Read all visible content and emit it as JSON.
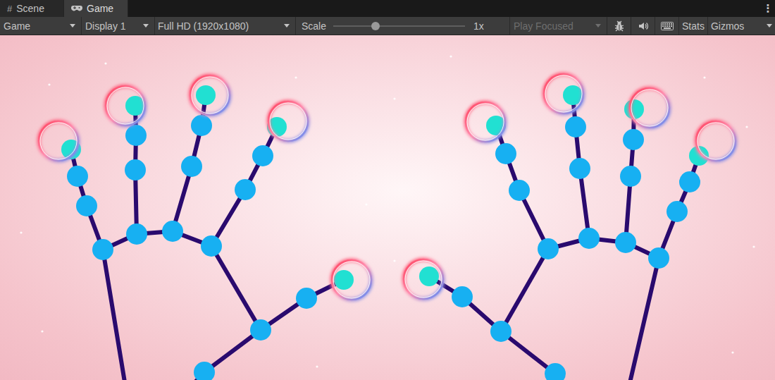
{
  "tabs": [
    {
      "label": "Scene",
      "glyph": "#",
      "selected": false
    },
    {
      "label": "Game",
      "glyph": "",
      "selected": true
    }
  ],
  "menu": "⋮",
  "toolbar": {
    "view_mode": "Game",
    "display": "Display 1",
    "resolution": "Full HD (1920x1080)",
    "scale": {
      "label": "Scale",
      "level": 0.32,
      "reading": "1x"
    },
    "play_mode": {
      "label": "Play Focused",
      "disabled": true
    },
    "toggles": [
      "Stats",
      "Gizmos"
    ]
  }
}
